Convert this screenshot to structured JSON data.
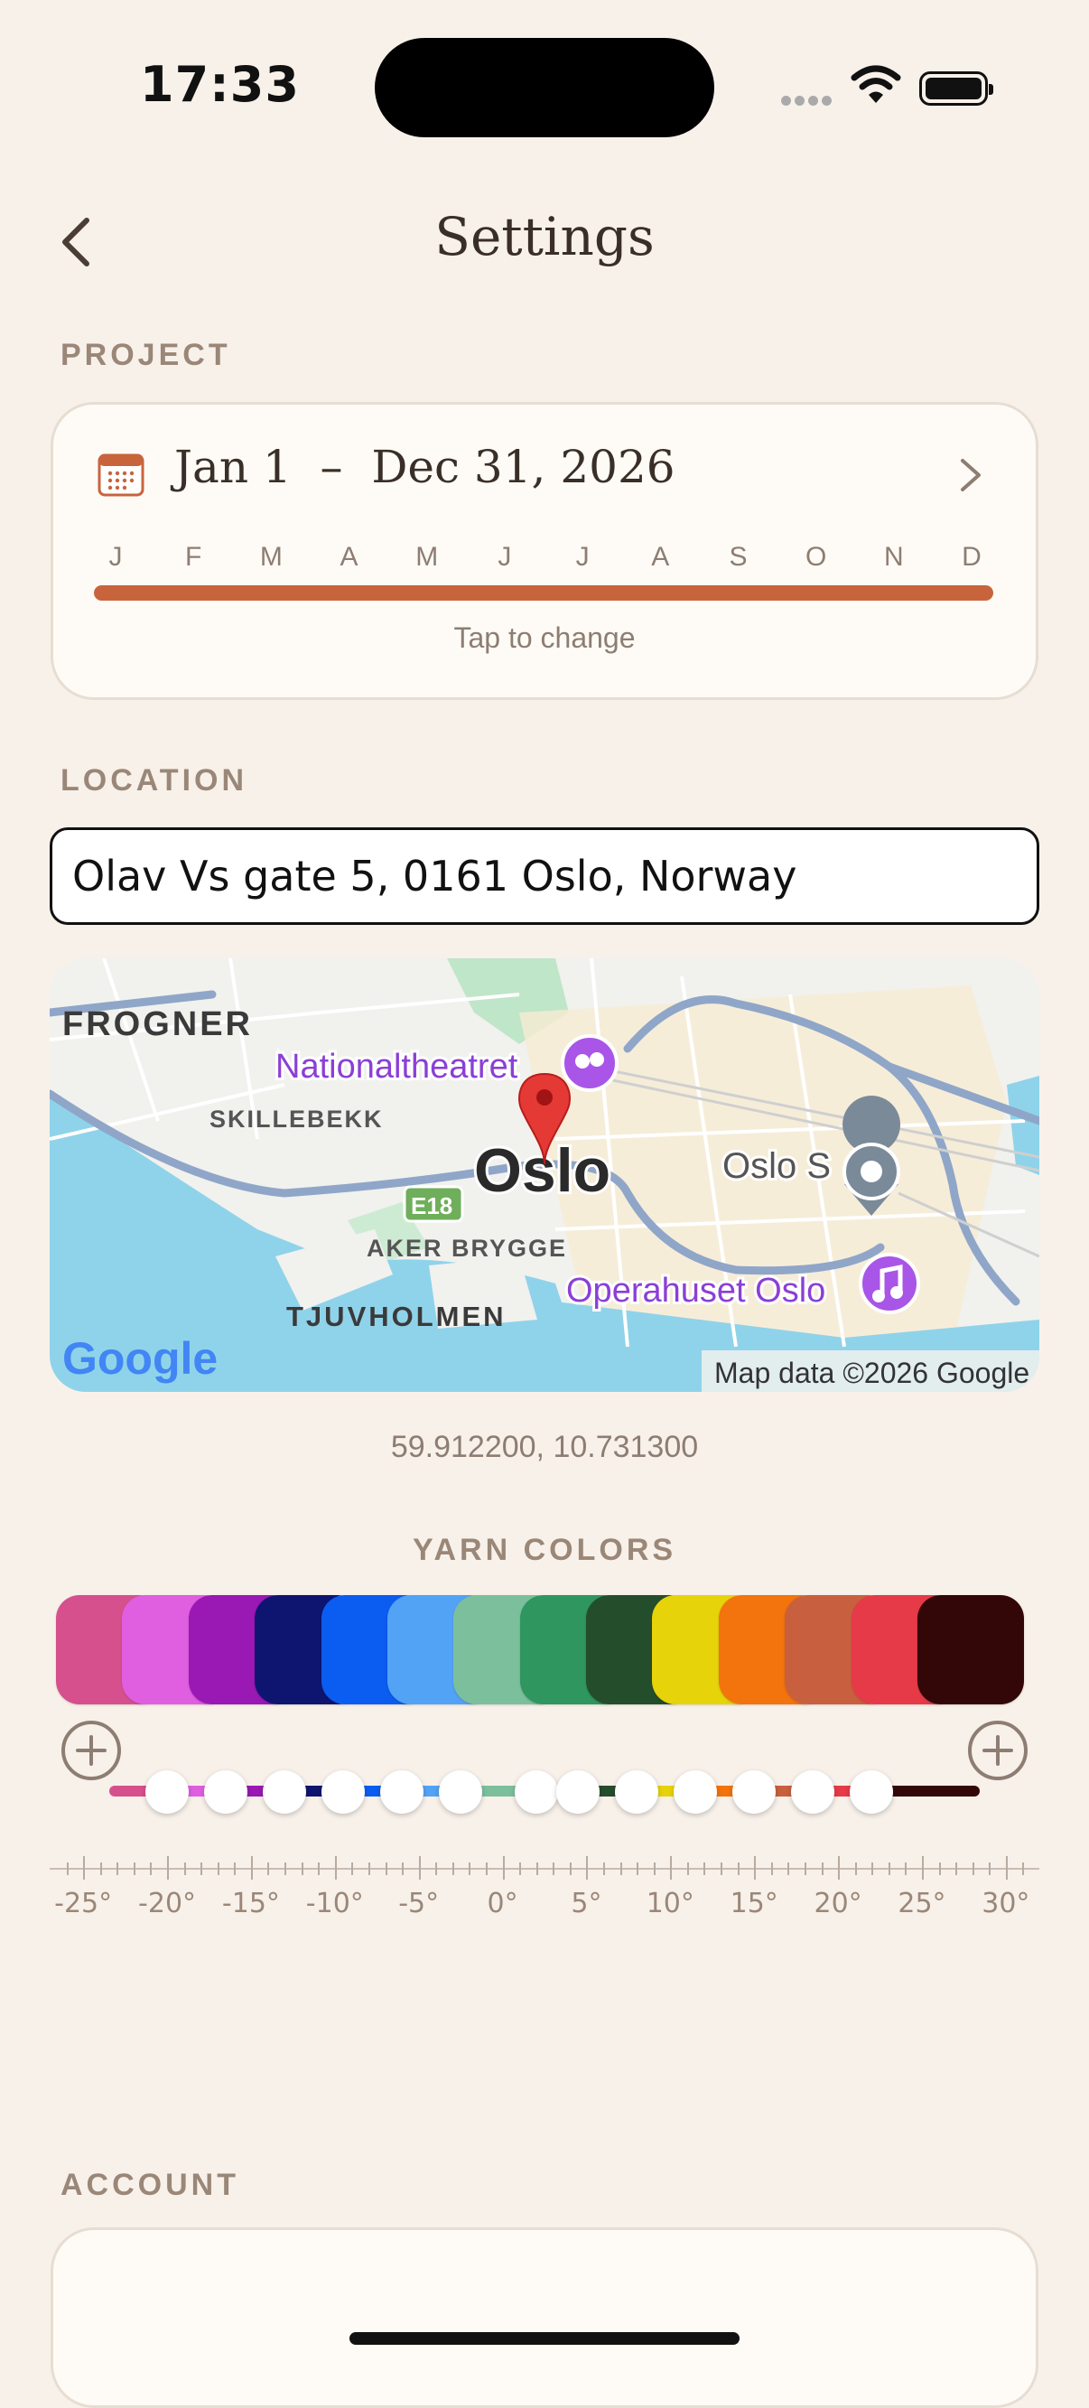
{
  "status_bar": {
    "time": "17:33"
  },
  "header": {
    "title": "Settings",
    "back_icon": "chevron-left-icon"
  },
  "project": {
    "section_label": "PROJECT",
    "date_range": "Jan 1  –  Dec 31, 2026",
    "months": [
      "J",
      "F",
      "M",
      "A",
      "M",
      "J",
      "J",
      "A",
      "S",
      "O",
      "N",
      "D"
    ],
    "tap_hint": "Tap to change",
    "accent_color": "#c8643c"
  },
  "location": {
    "section_label": "LOCATION",
    "address": "Olav Vs gate 5, 0161 Oslo, Norway",
    "map": {
      "labels": {
        "frogner": "FROGNER",
        "skillebekk": "SKILLEBEKK",
        "nationaltheatret": "Nationaltheatret",
        "oslo": "Oslo",
        "oslo_s": "Oslo S",
        "e18": "E18",
        "aker_brygge": "AKER BRYGGE",
        "tjuvholmen": "TJUVHOLMEN",
        "operahuset": "Operahuset Oslo",
        "attribution": "Map data ©2026 Google",
        "logo": "Google"
      }
    },
    "coordinates": "59.912200, 10.731300"
  },
  "yarn": {
    "section_label": "YARN COLORS",
    "colors": [
      "#d6508e",
      "#e05ee0",
      "#9a18b4",
      "#0e1570",
      "#0b5cf0",
      "#52a2f5",
      "#7cbf9c",
      "#2f9660",
      "#244d2c",
      "#e6d30a",
      "#f3730c",
      "#c8603f",
      "#e63a48",
      "#330707"
    ],
    "thresholds": [
      -20,
      -16.5,
      -13,
      -9.5,
      -6,
      -2.5,
      2,
      4.5,
      8,
      11.5,
      15,
      18.5,
      22
    ],
    "scale_labels": [
      "-25°",
      "-20°",
      "-15°",
      "-10°",
      "-5°",
      "0°",
      "5°",
      "10°",
      "15°",
      "20°",
      "25°",
      "30°"
    ]
  },
  "account": {
    "section_label": "ACCOUNT"
  }
}
